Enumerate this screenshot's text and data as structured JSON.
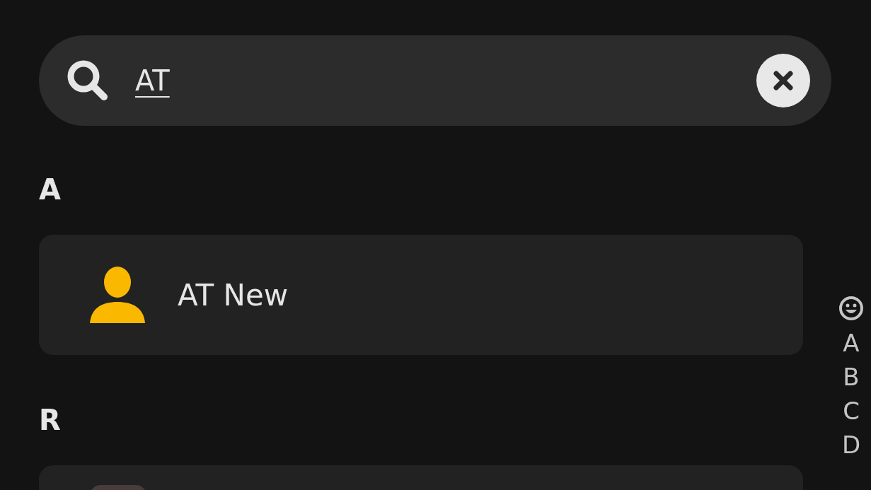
{
  "search": {
    "value": "AT"
  },
  "sections": [
    {
      "letter": "A",
      "contacts": [
        {
          "kind": "silhouette",
          "name": "AT New"
        }
      ]
    },
    {
      "letter": "R",
      "contacts": [
        {
          "kind": "photo"
        }
      ]
    }
  ],
  "index": [
    "A",
    "B",
    "C",
    "D"
  ]
}
